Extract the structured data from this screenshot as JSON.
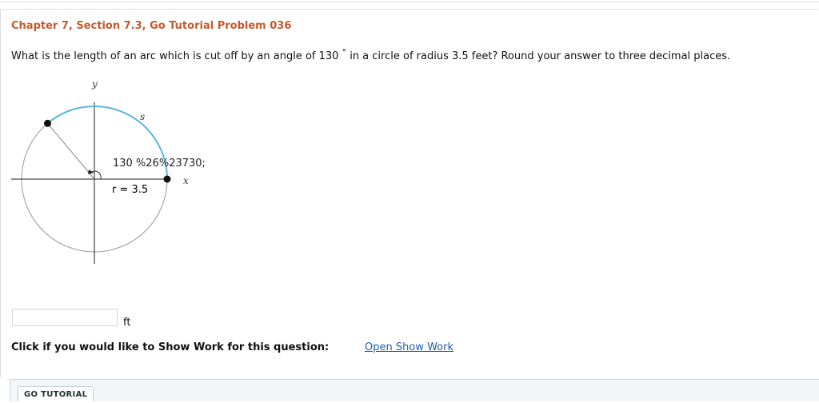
{
  "problem": {
    "title": "Chapter 7, Section 7.3, Go Tutorial Problem 036",
    "question_part1": "What is the length of an arc which is cut off by an angle of 130",
    "degree_symbol": "°",
    "question_part2": " in a circle of radius 3.5 feet? Round your answer to three decimal places."
  },
  "figure": {
    "y_label": "y",
    "x_label": "x",
    "arc_label": "s",
    "angle_label": "130 %26%23730;",
    "radius_label_var": "r",
    "radius_label_value": " = 3.5",
    "arc_color": "#5ab4e0"
  },
  "answer": {
    "value": "",
    "unit": "ft"
  },
  "show_work": {
    "prompt": "Click if you would like to Show Work for this question:",
    "link": "Open Show Work"
  },
  "footer": {
    "tutorial_button": "GO TUTORIAL"
  }
}
